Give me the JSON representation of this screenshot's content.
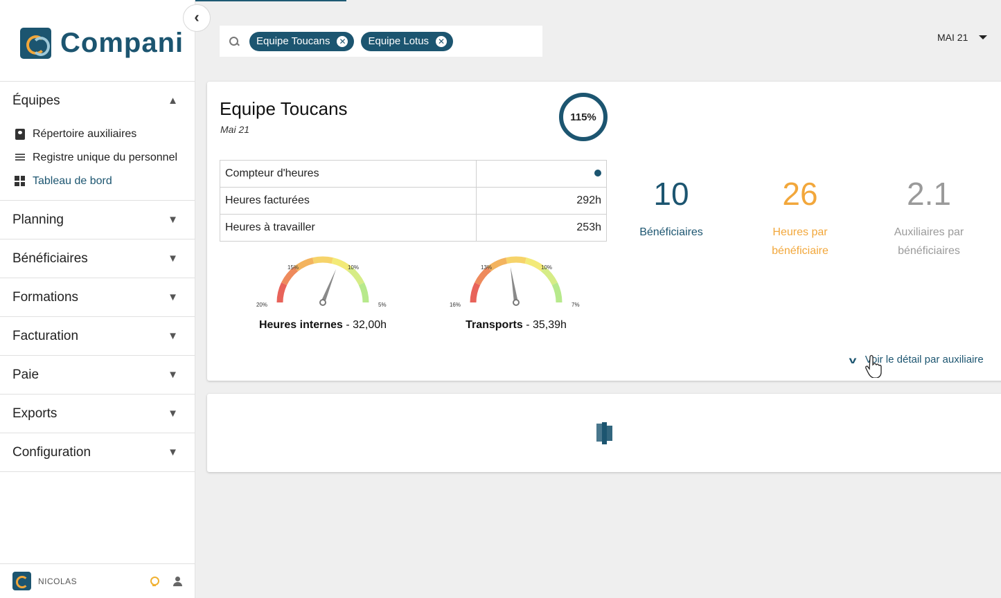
{
  "app": {
    "name": "Compani"
  },
  "sidebar": {
    "collapse_label": "‹",
    "sections": [
      {
        "label": "Équipes",
        "expanded": true,
        "chevron": "▲",
        "items": [
          {
            "label": "Répertoire auxiliaires",
            "icon": "contacts-book-icon"
          },
          {
            "label": "Registre unique du personnel",
            "icon": "list-lines-icon"
          },
          {
            "label": "Tableau de bord",
            "icon": "dashboard-grid-icon",
            "active": true
          }
        ]
      },
      {
        "label": "Planning",
        "chevron": "▼"
      },
      {
        "label": "Bénéficiaires",
        "chevron": "▼"
      },
      {
        "label": "Formations",
        "chevron": "▼"
      },
      {
        "label": "Facturation",
        "chevron": "▼"
      },
      {
        "label": "Paie",
        "chevron": "▼"
      },
      {
        "label": "Exports",
        "chevron": "▼"
      },
      {
        "label": "Configuration",
        "chevron": "▼"
      }
    ],
    "footer": {
      "username": "NICOLAS"
    }
  },
  "search": {
    "chips": [
      {
        "label": "Equipe Toucans",
        "remove": "✕"
      },
      {
        "label": "Equipe Lotus",
        "remove": "✕"
      }
    ]
  },
  "month_selector": {
    "value": "MAI 21"
  },
  "team_card": {
    "title": "Equipe Toucans",
    "subtitle": "Mai 21",
    "ring_value": "115%",
    "ring_fraction": 1.0,
    "table": [
      {
        "label": "Compteur d'heures",
        "value": ""
      },
      {
        "label": "Heures facturées",
        "value": "292h"
      },
      {
        "label": "Heures à travailler",
        "value": "253h"
      }
    ],
    "gauges": [
      {
        "name": "Heures internes",
        "value": " - 32,00h",
        "ticks": [
          "20%",
          "15%",
          "10%",
          "5%"
        ],
        "needle_fraction": 0.62
      },
      {
        "name": "Transports",
        "value": " - 35,39h",
        "ticks": [
          "16%",
          "13%",
          "10%",
          "7%"
        ],
        "needle_fraction": 0.45
      }
    ],
    "kpis": [
      {
        "value": "10",
        "label": "Bénéficiaires",
        "color": "#1c5570"
      },
      {
        "value": "26",
        "label": "Heures par bénéficiaire",
        "color": "#f2a73b"
      },
      {
        "value": "2.1",
        "label": "Auxiliaires par bénéficiaires",
        "color": "#9a9a9a"
      }
    ],
    "detail_link": "Voir le détail par auxiliaire"
  },
  "colors": {
    "brand": "#1c5570",
    "accent": "#f2a73b",
    "muted": "#9a9a9a"
  }
}
